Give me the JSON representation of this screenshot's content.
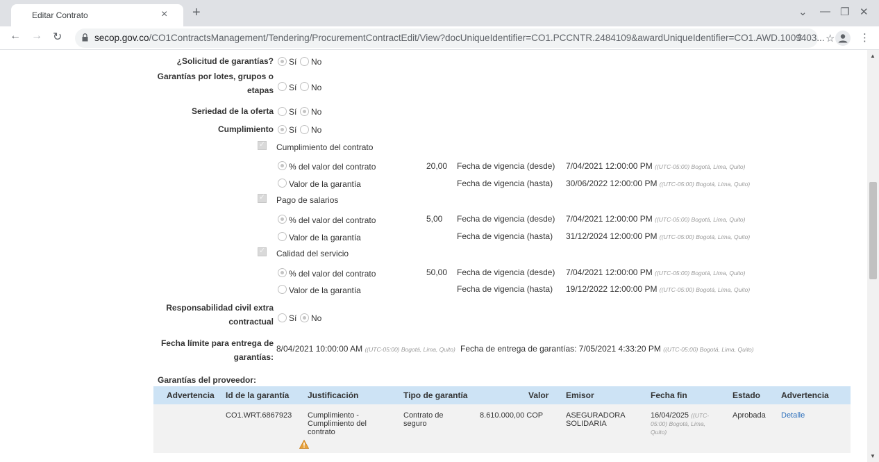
{
  "browser": {
    "tab_title": "Editar Contrato",
    "url_host": "secop.gov.co",
    "url_path": "/CO1ContractsManagement/Tendering/ProcurementContractEdit/View?docUniqueIdentifier=CO1.PCCNTR.2484109&awardUniqueIdentifier=CO1.AWD.1009403..."
  },
  "form": {
    "solicitud": {
      "label": "¿Solicitud de garantías?",
      "selected": "Sí"
    },
    "lotes": {
      "label_lines": [
        "Garantías por lotes, grupos o",
        "etapas"
      ],
      "selected": "none"
    },
    "seriedad": {
      "label": "Seriedad de la oferta",
      "selected": "No"
    },
    "cumplimiento": {
      "label": "Cumplimiento",
      "selected": "Sí"
    },
    "opt_si": "Sí",
    "opt_no": "No",
    "pct_label": "% del valor del contrato",
    "valor_label": "Valor de la garantía",
    "desde_label": "Fecha de vigencia (desde)",
    "hasta_label": "Fecha de vigencia (hasta)",
    "tz": "((UTC-05:00) Bogotá, Lima, Quito)",
    "amparos": [
      {
        "name": "Cumplimiento del contrato",
        "percent": "20,00",
        "desde": "7/04/2021 12:00:00 PM",
        "hasta": "30/06/2022 12:00:00 PM"
      },
      {
        "name": "Pago de salarios",
        "percent": "5,00",
        "desde": "7/04/2021 12:00:00 PM",
        "hasta": "31/12/2024 12:00:00 PM"
      },
      {
        "name": "Calidad del servicio",
        "percent": "50,00",
        "desde": "7/04/2021 12:00:00 PM",
        "hasta": "19/12/2022 12:00:00 PM"
      }
    ],
    "responsabilidad": {
      "label_lines": [
        "Responsabilidad civil extra",
        "contractual"
      ],
      "selected": "No"
    },
    "fecha_limite": {
      "label_lines": [
        "Fecha límite para entrega de",
        "garantías:"
      ],
      "value": "8/04/2021 10:00:00 AM"
    },
    "fecha_entrega": {
      "label": "Fecha de entrega de garantías:",
      "value": "7/05/2021 4:33:20 PM"
    }
  },
  "garantias": {
    "title": "Garantías del proveedor:",
    "columns": [
      "Advertencia",
      "Id de la garantía",
      "Justificación",
      "Tipo de garantía",
      "Valor",
      "Emisor",
      "Fecha fin",
      "Estado",
      "Advertencia"
    ],
    "rows": [
      {
        "id": "CO1.WRT.6867923",
        "justificacion": [
          "Cumplimiento -",
          "Cumplimiento del",
          "contrato"
        ],
        "tipo": [
          "Contrato de",
          "seguro"
        ],
        "valor": "8.610.000,00 COP",
        "emisor": [
          "ASEGURADORA",
          "SOLIDARIA"
        ],
        "fecha_fin": "16/04/2025",
        "fecha_fin_tz": [
          "((UTC-",
          "05:00) Bogotá, Lima,",
          "Quito)"
        ],
        "estado": "Aprobada",
        "accion": "Detalle"
      }
    ]
  }
}
